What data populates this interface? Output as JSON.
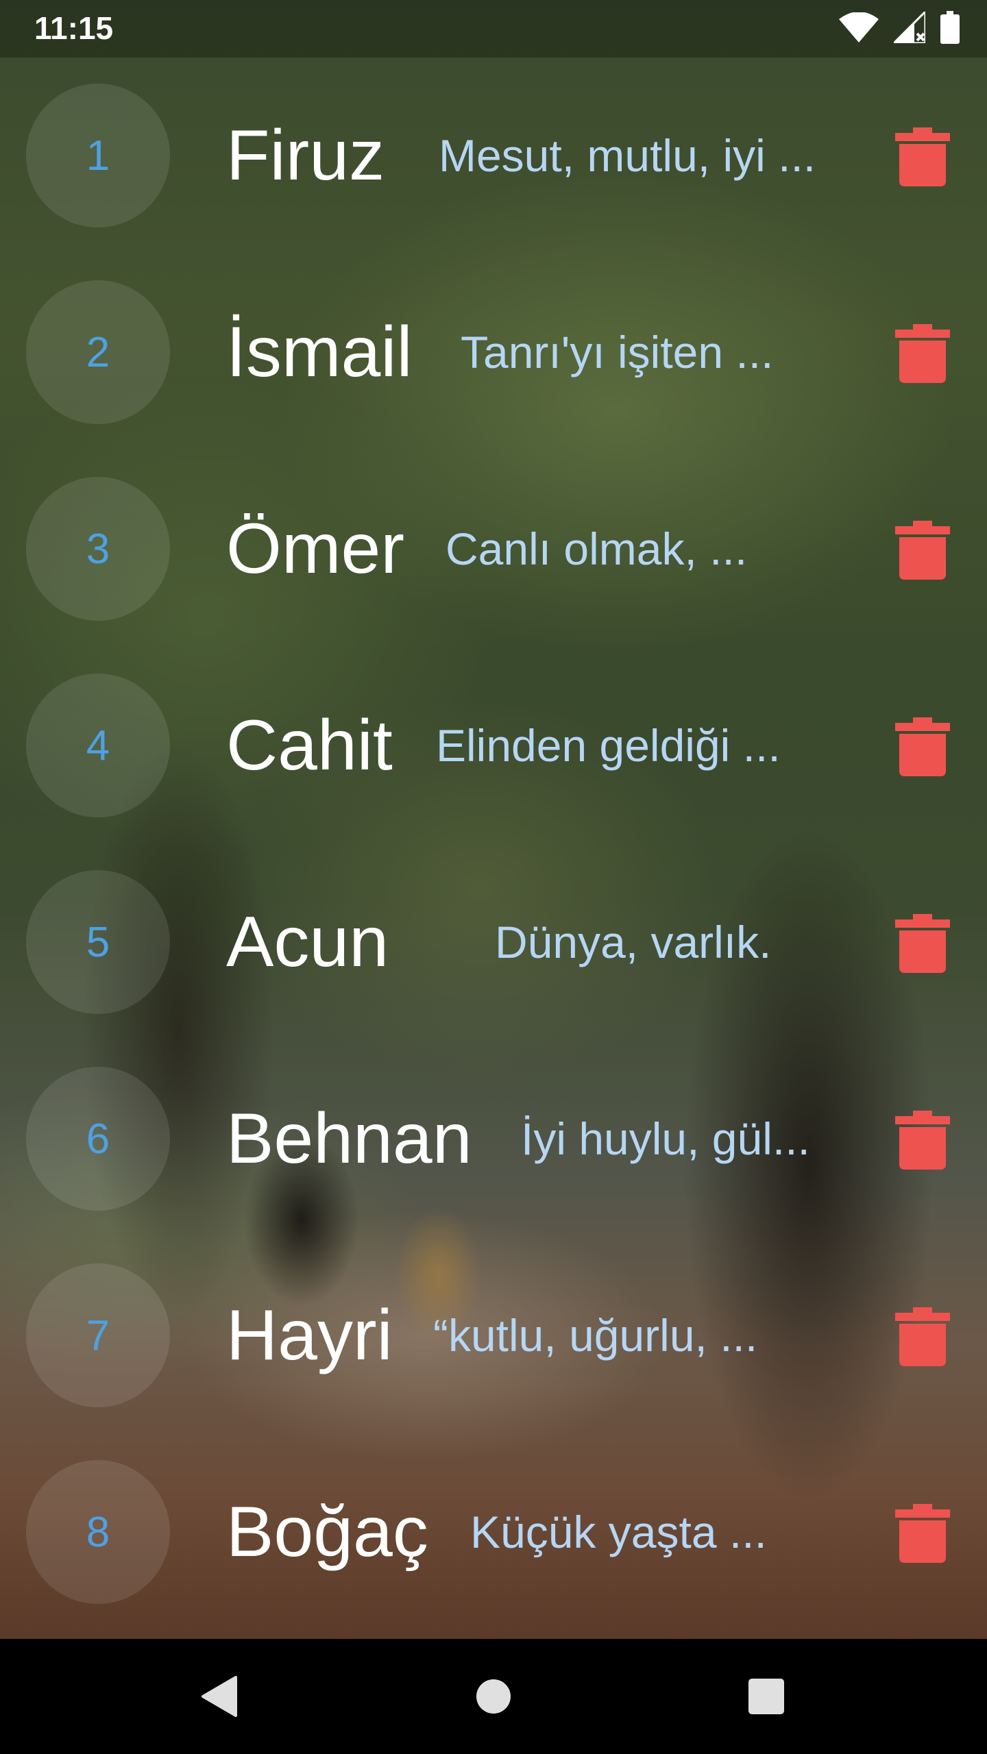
{
  "status_bar": {
    "time": "11:15",
    "icons": [
      "wifi-icon",
      "signal-no-data-icon",
      "battery-icon"
    ]
  },
  "names": [
    {
      "number": "1",
      "name": "Firuz",
      "meaning": "Mesut, mutlu, iyi ..."
    },
    {
      "number": "2",
      "name": "İsmail",
      "meaning": "Tanrı'yı işiten ..."
    },
    {
      "number": "3",
      "name": "Ömer",
      "meaning": "Canlı olmak, ..."
    },
    {
      "number": "4",
      "name": "Cahit",
      "meaning": "Elinden geldiği ..."
    },
    {
      "number": "5",
      "name": "Acun",
      "meaning": "Dünya, varlık."
    },
    {
      "number": "6",
      "name": "Behnan",
      "meaning": "İyi huylu, gül..."
    },
    {
      "number": "7",
      "name": "Hayri",
      "meaning": "“kutlu, uğurlu, ..."
    },
    {
      "number": "8",
      "name": "Boğaç",
      "meaning": "Küçük yaşta ..."
    }
  ],
  "row_action_icon": "trash-icon",
  "nav_bar": {
    "buttons": [
      "back-icon",
      "home-icon",
      "recents-icon"
    ]
  },
  "colors": {
    "number": "#4ea1e3",
    "name": "#ffffff",
    "meaning": "#b6d6f4",
    "delete": "#ef5350"
  }
}
